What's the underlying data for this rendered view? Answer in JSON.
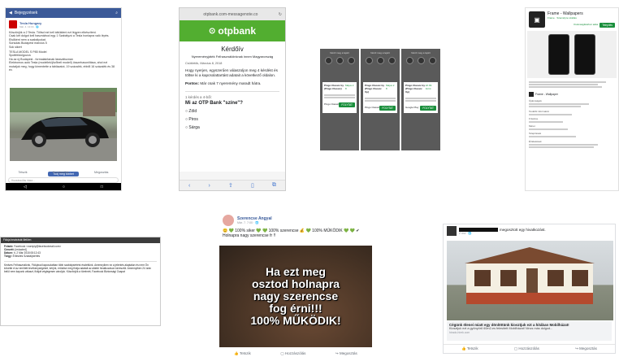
{
  "fb_post": {
    "back_label": "Bejegyzések",
    "author": "Tesla Hungary",
    "time": "Már. 4. 13:04 · 🌐",
    "lines": [
      "Köszönjük a 2 Tesla. Töltsd ezt kell átküldeni ezt légyen elkészíteni.",
      "Csak két dolgot kell használnod egy 1 Szabályzó a Tesla honlapra való lépés. Elsőként nem a szabályokat.",
      "Sorsolás Budapest március 5",
      "Sok sikert",
      "TESLA MODEL S P85 Model",
      "Spottfeldolgozva",
      "Ha az új Budapest - formalakítanak lássváltozóan",
      "Elektromos autó Tesla (modellek/jövőbeli modell) összehasonlítása, ahol ezt mutatjuk meg, hogy kimentette a táblázatot, 19 százalék, ebből 16 százalék és 38 év."
    ],
    "share_button": "Tudj meg többet",
    "actions": [
      "Tetszik",
      "Hozzászólás",
      "Megosztás"
    ],
    "comment_placeholder": "Hozzászólás írása..."
  },
  "otp": {
    "url": "otpbank.com-messagenote.co",
    "brand": "otpbank",
    "title": "Kérdőív",
    "subtitle": "Nyereményjáték Felhasználóinknak innen Magyarország",
    "date": "Csütörtök, Március 8, 2018",
    "intro": "Hogy nyerjen, egyszerűen válaszoljon meg 4 kérdést és töltse ki a kapcsolattartást adatait a következő oldalon.",
    "points_label": "Pontos:",
    "points_text": "Már csak 7 nyeremény maradt hátra.",
    "question_num": "1 kérdés a 4-ből:",
    "question": "Mi az OTP Bank \"színe\"?",
    "options": [
      "Zöld",
      "Piros",
      "Sárga"
    ]
  },
  "phones": {
    "header": "Nézd meg a lejárt",
    "cards": [
      {
        "title": "Pingo Classic by (Pingo Classic)",
        "price": "Május 2 8",
        "button": "FOLYTAT",
        "footer": "Pingo Classic"
      },
      {
        "title": "Pingo Classic by (Pingo Classic Up)",
        "price": "Május 2 8",
        "button": "FOLYTAT",
        "footer": "Pingo Classic"
      },
      {
        "title": "Pingo Classic by (Pingo Classic Up)",
        "price": "22.99 forint",
        "button": "FOLYTAT",
        "footer": "Google Play"
      }
    ]
  },
  "play": {
    "app_name": "Frame - Wallpapers",
    "developer": "Frame · Személyre szabás",
    "install": "Telepítés",
    "wishlist": "Kívánságlistához adás",
    "desc_title": "Frame - Wallpaper",
    "section_labels": [
      "Újdonságok",
      "További információ",
      "Frissítve",
      "Méret",
      "Telepítések"
    ],
    "review_note": "Értékelések"
  },
  "email": {
    "header": "Fiókja bezárását illetően",
    "from_label": "Feladó:",
    "from": "Facebook <noreply@facebookmail.com>",
    "to_label": "Címzett:",
    "to": "[redacted]",
    "date_label": "Dátum:",
    "date": "h, 2 Már 2018 08:12:43",
    "subject_label": "Tárgy:",
    "subject": "Értesítés Szabálysértés",
    "body": "Kedves Felhasználónk, Fiókjával kapcsolatban több szabálysértést észleltünk. Amennyiben ez a jelentés alaptalan és nem Ön követte el az említett tevékenységeket, kérjük, erősítse meg fiókja adatait az alábbi hivatkozáson keresztül. Amennyiben 24 órán belül nem kapunk választ, fiókját véglegesen zároljuk. Köszönjük a türelmét, Facebook Biztonsági Csapat"
  },
  "angyal": {
    "author": "Szerencse Angyal",
    "time": "Már. 7. 7:00 · 🌐",
    "caption": "😊 💚 100% siker 💚 💚 100% szerencse 💰 💚 100% MŰKÖDIK 💚 💚 ✔ Holnapra nagy szerencse fr !!",
    "image_text": [
      "Ha ezt meg",
      "osztod holnapra",
      "nagy szerencse",
      "fog érni!!!",
      "100% MŰKÖDIK!"
    ],
    "actions": [
      "Tetszik",
      "Hozzászólás",
      "Megosztás"
    ]
  },
  "mobilhaz": {
    "header_suffix": "megosztott egy hivatkozást.",
    "time": "2 óra · 🌐",
    "link_title": "Cégünk ölenei miatt egy dönlöttünk kiosztjuk ezt a hitában Mobilházat!",
    "link_desc": "Kiosztjuk ezt a gyönyörű 60m2-es felesített Mobilházat! Nincs más dolgod...",
    "link_domain": "hirado-hirek.com",
    "actions": [
      "Tetszik",
      "Hozzászólás",
      "Megosztás"
    ]
  }
}
